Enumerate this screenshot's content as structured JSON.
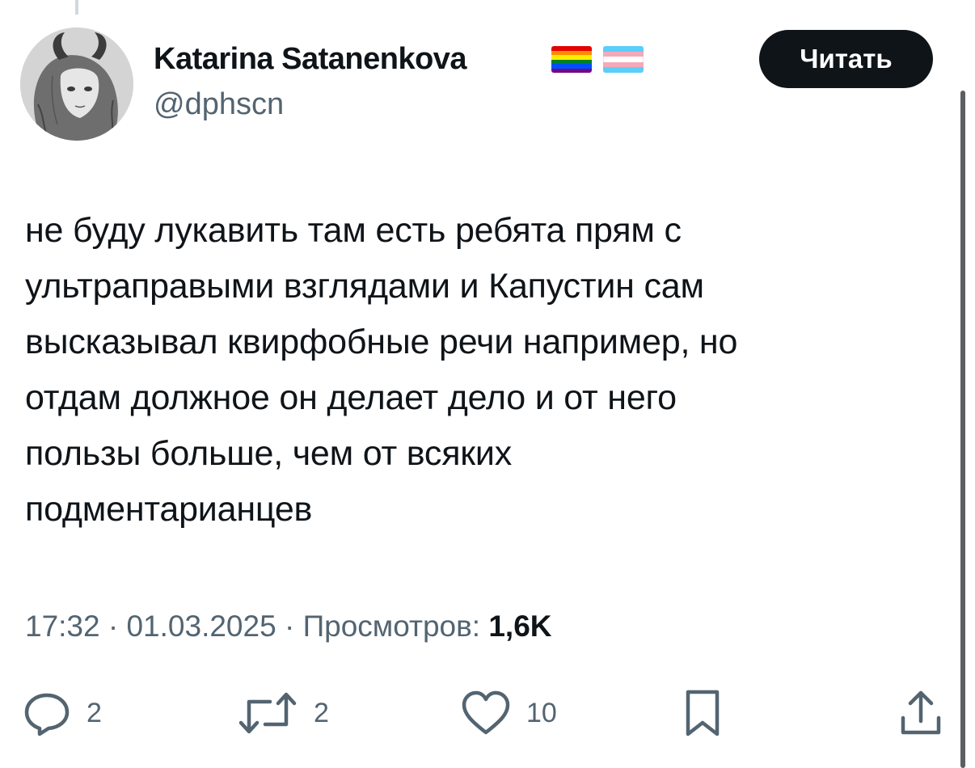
{
  "tweet": {
    "author": {
      "display_name": "Katarina Satanenkova",
      "handle": "@dphscn",
      "flags": [
        "rainbow-pride-flag",
        "transgender-flag"
      ]
    },
    "follow_label": "Читать",
    "text_lines": [
      "не буду лукавить там есть ребята прям с",
      "ультраправыми взглядами и Капустин сам",
      "высказывал квирфобные речи например, но",
      "отдам должное он делает дело и от него",
      "пользы больше, чем от всяких",
      "подментарианцев"
    ],
    "time": "17:32",
    "date": "01.03.2025",
    "views_label": "Просмотров:",
    "views_count": "1,6K",
    "separator": " · "
  },
  "actions": {
    "replies": {
      "icon": "reply-icon",
      "count": "2"
    },
    "retweets": {
      "icon": "retweet-icon",
      "count": "2"
    },
    "likes": {
      "icon": "heart-icon",
      "count": "10"
    },
    "bookmark": {
      "icon": "bookmark-icon"
    },
    "share": {
      "icon": "share-icon"
    }
  },
  "colors": {
    "text": "#0f1419",
    "secondary": "#536471",
    "button_bg": "#0f1419",
    "button_text": "#ffffff"
  }
}
